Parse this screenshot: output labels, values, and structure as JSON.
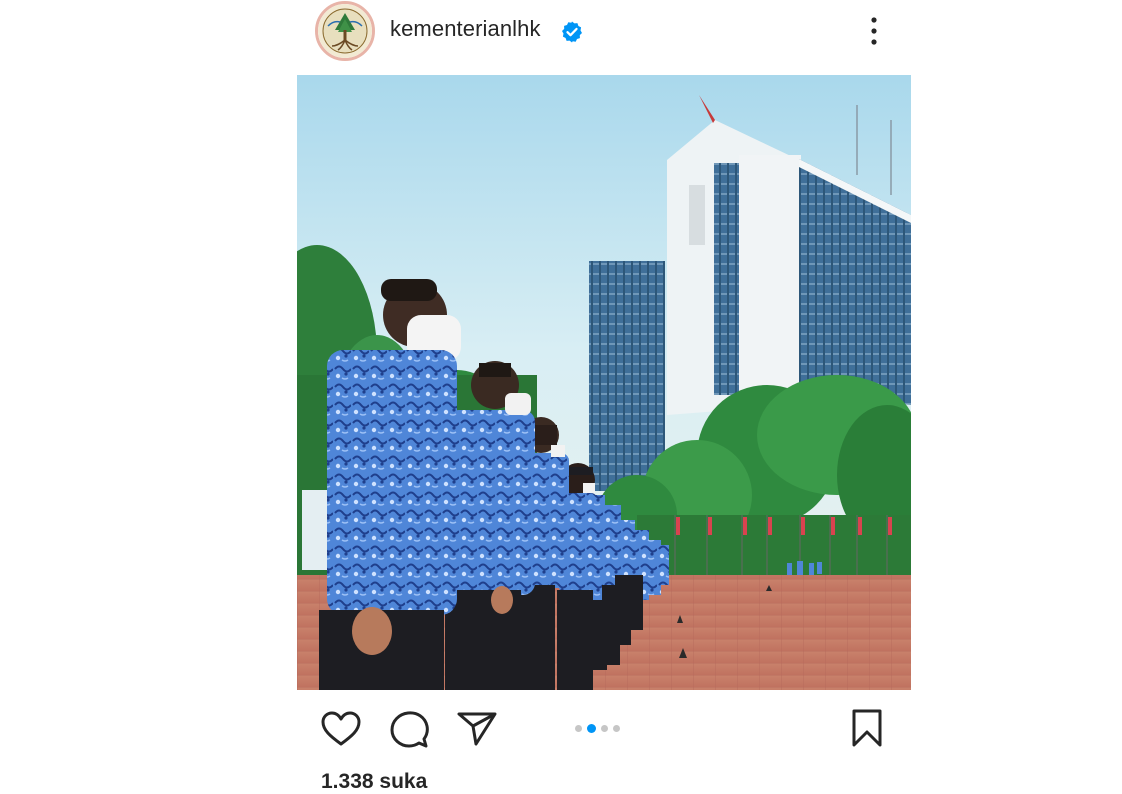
{
  "header": {
    "username": "kementerianlhk",
    "verified": true,
    "avatar": "kementerian-lhk-logo",
    "more_icon": "more-vertical-icon"
  },
  "post": {
    "image": "officials-in-blue-batik-shirts-lined-up-in-front-of-ministry-building",
    "carousel": {
      "count": 4,
      "active_index": 1
    }
  },
  "actions": {
    "like_icon": "heart-icon",
    "comment_icon": "comment-icon",
    "share_icon": "send-icon",
    "save_icon": "bookmark-icon"
  },
  "likes": {
    "text": "1.338 suka"
  },
  "colors": {
    "accent": "#0095f6",
    "text": "#262626",
    "inactive_dot": "#c6c6c6"
  }
}
